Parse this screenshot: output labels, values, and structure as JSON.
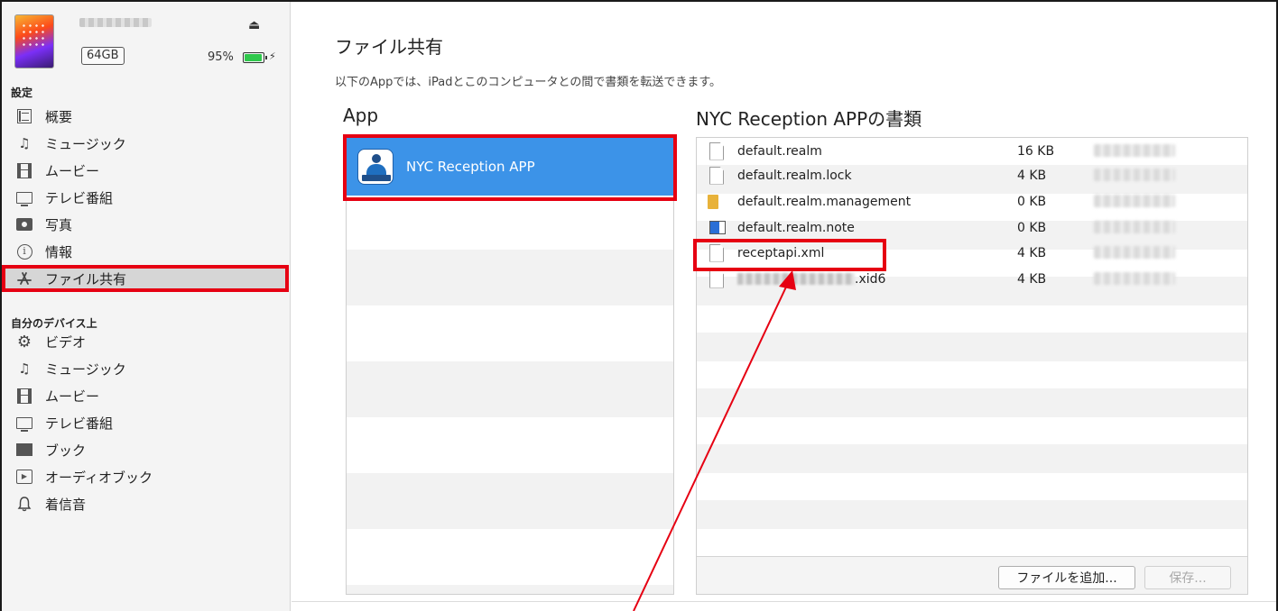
{
  "device": {
    "capacity": "64GB",
    "battery_percent": "95%",
    "battery_level": 0.95,
    "eject_glyph": "⏏",
    "charging_glyph": "⚡"
  },
  "sidebar": {
    "settings_label": "設定",
    "settings_items": [
      {
        "label": "概要",
        "icon": "list-icon"
      },
      {
        "label": "ミュージック",
        "icon": "music-note-icon"
      },
      {
        "label": "ムービー",
        "icon": "film-icon"
      },
      {
        "label": "テレビ番組",
        "icon": "tv-icon"
      },
      {
        "label": "写真",
        "icon": "camera-icon"
      },
      {
        "label": "情報",
        "icon": "info-icon"
      },
      {
        "label": "ファイル共有",
        "icon": "app-store-icon"
      }
    ],
    "on_device_label": "自分のデバイス上",
    "device_items": [
      {
        "label": "ビデオ",
        "icon": "gear-icon"
      },
      {
        "label": "ミュージック",
        "icon": "music-note-icon"
      },
      {
        "label": "ムービー",
        "icon": "film-icon"
      },
      {
        "label": "テレビ番組",
        "icon": "tv-icon"
      },
      {
        "label": "ブック",
        "icon": "book-icon"
      },
      {
        "label": "オーディオブック",
        "icon": "audiobook-icon"
      },
      {
        "label": "着信音",
        "icon": "bell-icon"
      }
    ]
  },
  "main": {
    "title": "ファイル共有",
    "subtitle": "以下のAppでは、iPadとこのコンピュータとの間で書類を転送できます。",
    "app_column_header": "App",
    "docs_column_header": "NYC Reception APPの書類",
    "apps": [
      {
        "name": "NYC Reception APP"
      }
    ],
    "documents": [
      {
        "name": "default.realm",
        "size": "16 KB",
        "icon": "file-icon"
      },
      {
        "name": "default.realm.lock",
        "size": "4 KB",
        "icon": "file-icon"
      },
      {
        "name": "default.realm.management",
        "size": "0 KB",
        "icon": "folder-icon"
      },
      {
        "name": "default.realm.note",
        "size": "0 KB",
        "icon": "note-icon"
      },
      {
        "name": "receptapi.xml",
        "size": "4 KB",
        "icon": "file-icon"
      },
      {
        "name": ".xid6",
        "size": "4 KB",
        "icon": "file-icon"
      }
    ],
    "add_file_button": "ファイルを追加...",
    "save_button": "保存..."
  },
  "colors": {
    "highlight": "#e60012",
    "selection": "#3c93e8",
    "battery": "#2fc84c"
  }
}
